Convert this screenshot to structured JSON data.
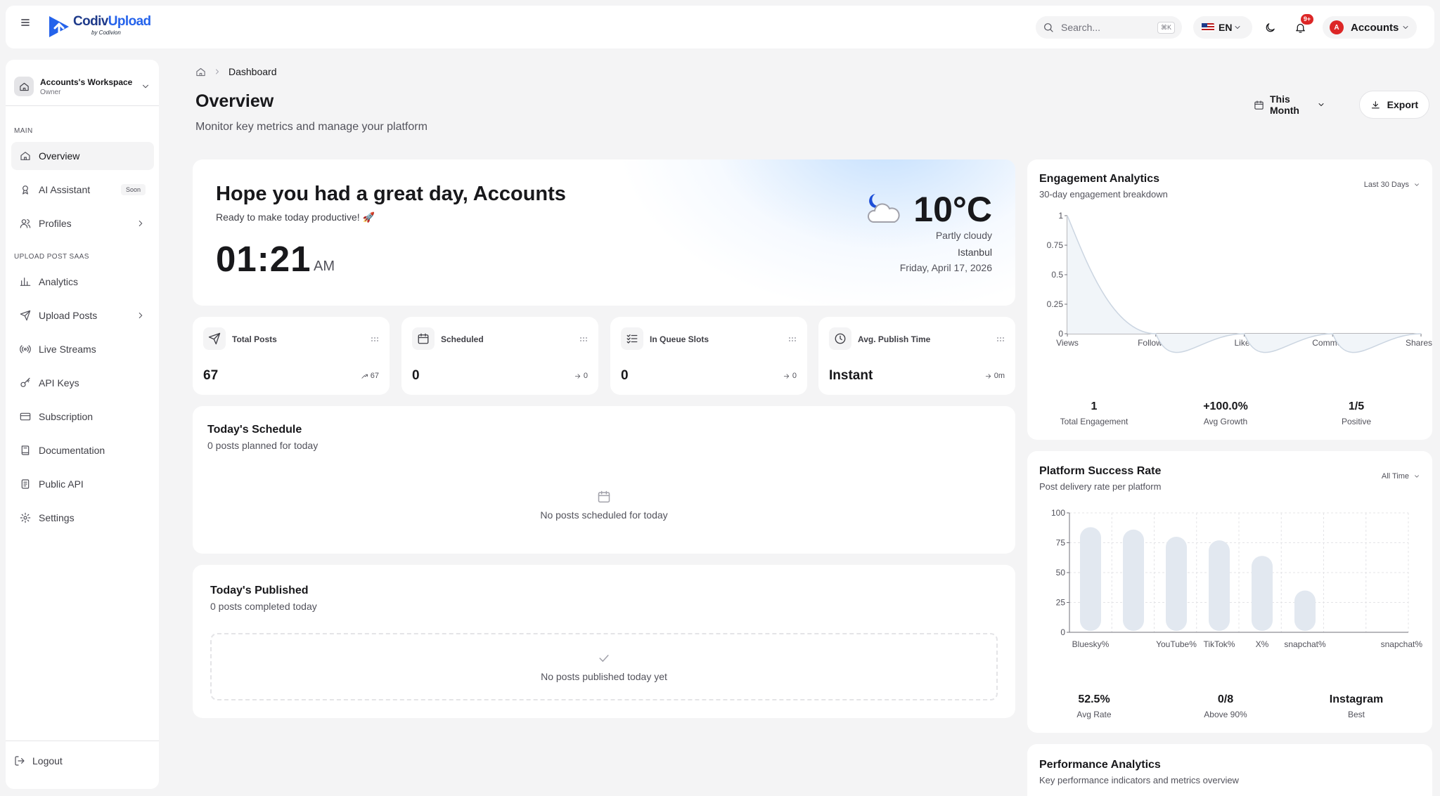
{
  "brand": {
    "name_part1": "Codiv",
    "name_part2": "Upload",
    "byline": "by Codivion"
  },
  "topbar": {
    "search_placeholder": "Search...",
    "search_shortcut": "⌘K",
    "language": "EN",
    "notifications_badge": "9+",
    "account_initial": "A",
    "account_label": "Accounts"
  },
  "sidebar": {
    "workspace_name": "Accounts's Workspace",
    "workspace_role": "Owner",
    "section_main": "MAIN",
    "section_upload": "UPLOAD POST SAAS",
    "items": [
      {
        "label": "Overview",
        "icon": "home-icon",
        "active": true
      },
      {
        "label": "AI Assistant",
        "icon": "bot-icon",
        "badge": "Soon"
      },
      {
        "label": "Profiles",
        "icon": "users-icon",
        "has_children": true
      },
      {
        "label": "Analytics",
        "icon": "bar-chart-icon"
      },
      {
        "label": "Upload Posts",
        "icon": "send-icon",
        "has_children": true
      },
      {
        "label": "Live Streams",
        "icon": "broadcast-icon"
      },
      {
        "label": "API Keys",
        "icon": "key-icon"
      },
      {
        "label": "Subscription",
        "icon": "credit-card-icon"
      },
      {
        "label": "Documentation",
        "icon": "book-icon"
      },
      {
        "label": "Public API",
        "icon": "file-icon"
      },
      {
        "label": "Settings",
        "icon": "gear-icon"
      }
    ],
    "logout": "Logout"
  },
  "breadcrumb": {
    "current": "Dashboard"
  },
  "header": {
    "title": "Overview",
    "subtitle": "Monitor key metrics and manage your platform",
    "period": "This Month",
    "export": "Export"
  },
  "greeting": {
    "title": "Hope you had a great day, Accounts",
    "subtitle": "Ready to make today productive! 🚀",
    "time": "01:21",
    "ampm": "AM",
    "temperature": "10°C",
    "condition": "Partly cloudy",
    "city": "Istanbul",
    "date": "Friday, April 17, 2026"
  },
  "stats": [
    {
      "label": "Total Posts",
      "value": "67",
      "delta": "67",
      "icon": "send-icon",
      "trend": "up"
    },
    {
      "label": "Scheduled",
      "value": "0",
      "delta": "0",
      "icon": "calendar-icon",
      "trend": "flat"
    },
    {
      "label": "In Queue Slots",
      "value": "0",
      "delta": "0",
      "icon": "list-check-icon",
      "trend": "flat"
    },
    {
      "label": "Avg. Publish Time",
      "value": "Instant",
      "delta": "0m",
      "icon": "clock-icon",
      "trend": "flat"
    }
  ],
  "schedule": {
    "title": "Today's Schedule",
    "subtitle": "0 posts planned for today",
    "empty": "No posts scheduled for today"
  },
  "published": {
    "title": "Today's Published",
    "subtitle": "0 posts completed today",
    "empty": "No posts published today yet"
  },
  "engagement": {
    "title": "Engagement Analytics",
    "subtitle": "30-day engagement breakdown",
    "range": "Last 30 Days",
    "metrics": [
      {
        "value": "1",
        "label": "Total Engagement"
      },
      {
        "value": "+100.0%",
        "label": "Avg Growth"
      },
      {
        "value": "1/5",
        "label": "Positive"
      }
    ]
  },
  "platform": {
    "title": "Platform Success Rate",
    "subtitle": "Post delivery rate per platform",
    "range": "All Time",
    "metrics": [
      {
        "value": "52.5%",
        "label": "Avg Rate"
      },
      {
        "value": "0/8",
        "label": "Above 90%"
      },
      {
        "value": "Instagram",
        "label": "Best"
      }
    ]
  },
  "performance": {
    "title": "Performance Analytics",
    "subtitle": "Key performance indicators and metrics overview"
  },
  "chart_data": [
    {
      "type": "area",
      "categories": [
        "Views",
        "Followers",
        "Likes",
        "Comments",
        "Shares"
      ],
      "values": [
        1,
        0,
        0,
        0,
        0
      ],
      "yticks": [
        "0",
        "0.25",
        "0.5",
        "0.75",
        "1"
      ],
      "ylim": [
        0,
        1
      ],
      "color": "#cbd5e1"
    },
    {
      "type": "bar",
      "categories": [
        "Bluesky%",
        "",
        "YouTube%",
        "TikTok%",
        "X%",
        "snapchat%"
      ],
      "values": [
        88,
        86,
        80,
        77,
        64,
        35
      ],
      "yticks": [
        "0",
        "25",
        "50",
        "75",
        "100"
      ],
      "ylim": [
        0,
        100
      ],
      "grid": true,
      "color": "#e2e8f0"
    }
  ]
}
